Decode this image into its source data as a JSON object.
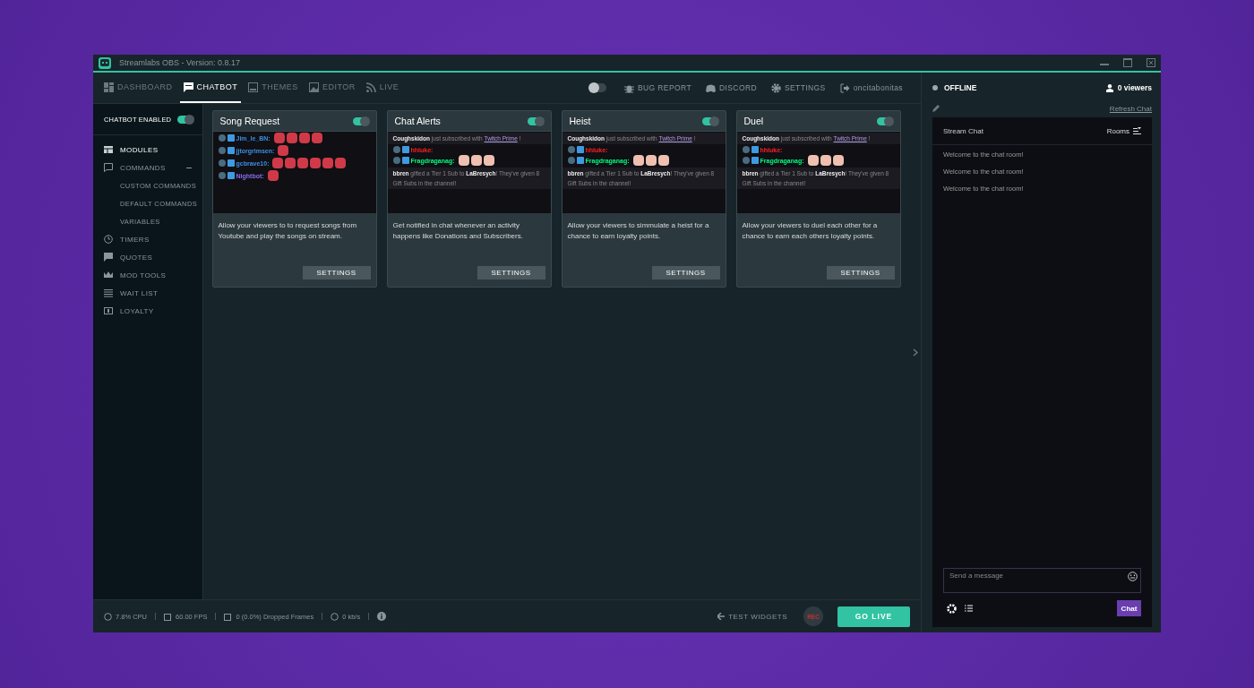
{
  "window": {
    "title": "Streamlabs OBS - Version: 0.8.17"
  },
  "nav_tabs": [
    {
      "label": "DASHBOARD",
      "selected": false
    },
    {
      "label": "CHATBOT",
      "selected": true
    },
    {
      "label": "THEMES",
      "selected": false
    },
    {
      "label": "EDITOR",
      "selected": false
    },
    {
      "label": "LIVE",
      "selected": false
    }
  ],
  "top_actions": [
    "BUG REPORT",
    "DISCORD",
    "SETTINGS",
    "oncitabonitas"
  ],
  "night_mode": {
    "on": false
  },
  "sidebar": {
    "chatbot_enabled": {
      "label": "CHATBOT ENABLED",
      "on": true
    },
    "items": [
      {
        "label": "MODULES",
        "selected": true
      },
      {
        "label": "COMMANDS",
        "selected": false,
        "expanded": true,
        "children": [
          {
            "label": "CUSTOM COMMANDS",
            "selected": false
          },
          {
            "label": "DEFAULT COMMANDS",
            "selected": false
          },
          {
            "label": "VARIABLES",
            "selected": false
          }
        ]
      },
      {
        "label": "TIMERS",
        "selected": false
      },
      {
        "label": "QUOTES",
        "selected": false
      },
      {
        "label": "MOD TOOLS",
        "selected": false
      },
      {
        "label": "WAIT LIST",
        "selected": false
      },
      {
        "label": "LOYALTY",
        "selected": false
      }
    ]
  },
  "modules": [
    {
      "title": "Song Request",
      "enabled": true,
      "preview": [
        {
          "kind": "chat",
          "user": "Jim_le_BN:",
          "color": "#3b8fe0"
        },
        {
          "kind": "chat",
          "user": "jjtorgrimsen:",
          "color": "#3b8fe0"
        },
        {
          "kind": "chat",
          "user": "gcbrave10:",
          "color": "#3b8fe0"
        },
        {
          "kind": "chat",
          "user": "Nightbot:",
          "color": "#8a6cf0"
        }
      ],
      "description": "Allow your viewers to to request songs from Youtube and play the songs on stream.",
      "button": "SETTINGS"
    },
    {
      "title": "Chat Alerts",
      "enabled": true,
      "preview": [
        {
          "kind": "notice",
          "text": "**Coughskidon** just subscribed with",
          "link": "Twitch Prime",
          "tail": "!"
        },
        {
          "kind": "chat",
          "user": "hhluke:",
          "color": "#ff2020"
        },
        {
          "kind": "chat",
          "user": "Fragdraganag:",
          "color": "#00ff7f"
        },
        {
          "kind": "notice",
          "text": "**bbren** gifted a Tier 1 Sub to **LaBresych**! They've given 8 Gift Subs in the channel!"
        }
      ],
      "description": "Get notified in chat whenever an activity happens like Donations and Subscribers.",
      "button": "SETTINGS"
    },
    {
      "title": "Heist",
      "enabled": true,
      "preview": [
        {
          "kind": "notice",
          "text": "**Coughskidon** just subscribed with",
          "link": "Twitch Prime",
          "tail": "!"
        },
        {
          "kind": "chat",
          "user": "hhluke:",
          "color": "#ff2020"
        },
        {
          "kind": "chat",
          "user": "Fragdraganag:",
          "color": "#00ff7f"
        },
        {
          "kind": "notice",
          "text": "**bbren** gifted a Tier 1 Sub to **LaBresych**! They've given 8 Gift Subs in the channel!"
        }
      ],
      "description": "Allow your viewers to simmulate a heist for a chance to earn loyalty points.",
      "button": "SETTINGS"
    },
    {
      "title": "Duel",
      "enabled": true,
      "preview": [
        {
          "kind": "notice",
          "text": "**Coughskidon** just subscribed with",
          "link": "Twitch Prime",
          "tail": "!"
        },
        {
          "kind": "chat",
          "user": "hhluke:",
          "color": "#ff2020"
        },
        {
          "kind": "chat",
          "user": "Fragdraganag:",
          "color": "#00ff7f"
        },
        {
          "kind": "notice",
          "text": "**bbren** gifted a Tier 1 Sub to **LaBresych**! They've given 8 Gift Subs in the channel!"
        }
      ],
      "description": "Allow your viewers to duel each other for a chance to earn each others loyalty points.",
      "button": "SETTINGS"
    }
  ],
  "status_bar": {
    "stats": [
      "7.8% CPU",
      "60.00 FPS",
      "0 (0.0%) Dropped Frames",
      "0 kb/s"
    ],
    "test_widgets": "TEST WIDGETS",
    "rec": "REC",
    "go_live": "GO LIVE"
  },
  "chat_panel": {
    "status": "OFFLINE",
    "viewers": "0 viewers",
    "refresh": "Refresh Chat",
    "title": "Stream Chat",
    "rooms": "Rooms",
    "messages": [
      "Welcome to the chat room!",
      "Welcome to the chat room!",
      "Welcome to the chat room!"
    ],
    "input_placeholder": "Send a message",
    "send": "Chat"
  }
}
